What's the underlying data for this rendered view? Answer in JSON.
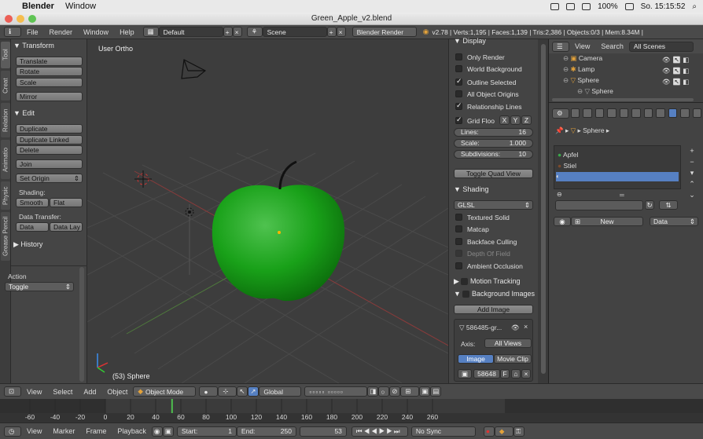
{
  "macbar": {
    "app_name": "Blender",
    "menu_window": "Window",
    "battery": "100%",
    "clock": "So. 15:15:52"
  },
  "window": {
    "title": "Green_Apple_v2.blend"
  },
  "info_header": {
    "menus": [
      "File",
      "Render",
      "Window",
      "Help"
    ],
    "layout": "Default",
    "scene": "Scene",
    "engine": "Blender Render",
    "stats": "v2.78 | Verts:1,195 | Faces:1,139 | Tris:2,386 | Objects:0/3 | Mem:8.34M |"
  },
  "tool_tabs": [
    "Tool",
    "Creat",
    "Relation",
    "Animatio",
    "Physic",
    "Grease Pencil"
  ],
  "toolshelf": {
    "transform_header": "Transform",
    "transform_buttons": [
      "Translate",
      "Rotate",
      "Scale",
      "Mirror"
    ],
    "edit_header": "Edit",
    "edit_buttons": [
      "Duplicate",
      "Duplicate Linked",
      "Delete",
      "Join"
    ],
    "set_origin": "Set Origin",
    "shading_label": "Shading:",
    "smooth": "Smooth",
    "flat": "Flat",
    "data_transfer_label": "Data Transfer:",
    "data": "Data",
    "data_lay": "Data Lay",
    "history_header": "History",
    "action_label": "Action",
    "action_value": "Toggle"
  },
  "viewport": {
    "view_label": "User Ortho",
    "object_label": "(53) Sphere"
  },
  "npanel": {
    "display_header": "Display",
    "checks": [
      {
        "label": "Only Render",
        "on": false
      },
      {
        "label": "World Background",
        "on": false
      },
      {
        "label": "Outline Selected",
        "on": true
      },
      {
        "label": "All Object Origins",
        "on": false
      },
      {
        "label": "Relationship Lines",
        "on": true
      }
    ],
    "grid_floor": "Grid Floo",
    "axes": [
      "X",
      "Y",
      "Z"
    ],
    "lines_label": "Lines:",
    "lines_value": "16",
    "scale_label": "Scale:",
    "scale_value": "1.000",
    "subdiv_label": "Subdivisions:",
    "subdiv_value": "10",
    "toggle_quad": "Toggle Quad View",
    "shading_header": "Shading",
    "shading_mode": "GLSL",
    "shading_checks": [
      "Textured Solid",
      "Matcap",
      "Backface Culling",
      "Depth Of Field",
      "Ambient Occlusion"
    ],
    "motion_tracking": "Motion Tracking",
    "background_images": "Background Images",
    "add_image": "Add Image",
    "bg_image_name": "586485-gr...",
    "axis_label": "Axis:",
    "axis_value": "All Views",
    "image_tab": "Image",
    "movie_clip_tab": "Movie Clip",
    "frame_value": "58648",
    "frame_f": "F"
  },
  "outliner": {
    "menus": [
      "View",
      "Search"
    ],
    "filter": "All Scenes",
    "items": [
      "Camera",
      "Lamp",
      "Sphere",
      "Sphere"
    ]
  },
  "properties": {
    "breadcrumb": "Sphere",
    "materials": [
      "Apfel",
      "Stiel",
      ""
    ],
    "new_button": "New",
    "data_dropdown": "Data"
  },
  "view3d_header": {
    "menus": [
      "View",
      "Select",
      "Add",
      "Object"
    ],
    "mode": "Object Mode",
    "orientation": "Global"
  },
  "timeline": {
    "ticks": [
      "-60",
      "-40",
      "-20",
      "0",
      "20",
      "40",
      "60",
      "80",
      "100",
      "120",
      "140",
      "160",
      "180",
      "200",
      "220",
      "240",
      "260"
    ],
    "current_frame": 53
  },
  "timeline_header": {
    "menus": [
      "View",
      "Marker",
      "Frame",
      "Playback"
    ],
    "start": "Start:",
    "start_value": "1",
    "end": "End:",
    "end_value": "250",
    "current": "53",
    "sync": "No Sync"
  }
}
